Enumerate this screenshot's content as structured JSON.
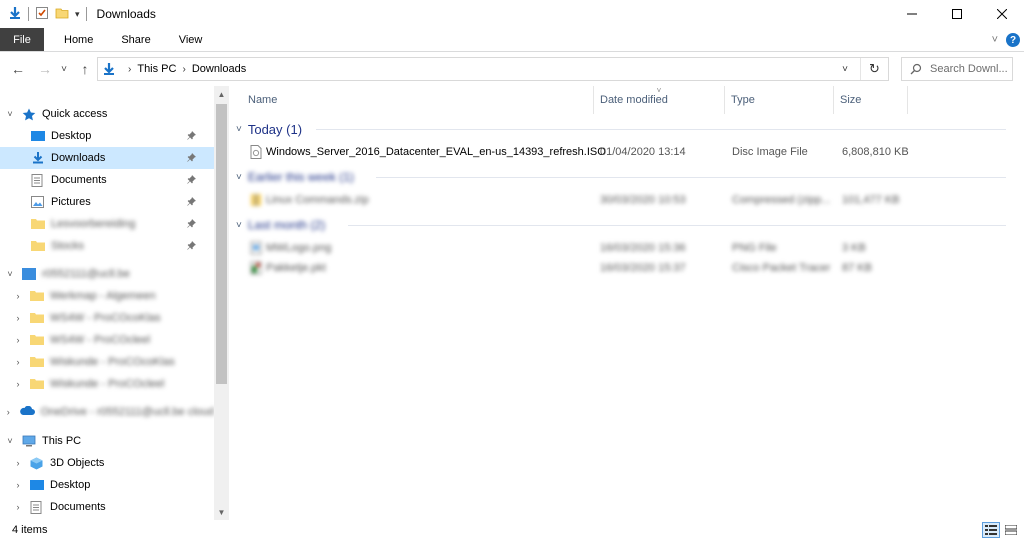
{
  "window": {
    "title": "Downloads",
    "controls": {
      "minimize": "—",
      "maximize": "☐",
      "close": "✕"
    }
  },
  "ribbon": {
    "tabs": [
      {
        "label": "File"
      },
      {
        "label": "Home"
      },
      {
        "label": "Share"
      },
      {
        "label": "View"
      }
    ],
    "expand": "˅",
    "help": "?"
  },
  "navbar": {
    "back": "←",
    "forward": "→",
    "recent": "˅",
    "up": "↑",
    "breadcrumb": [
      "This PC",
      "Downloads"
    ],
    "dropdown": "˅",
    "refresh": "↻",
    "search_placeholder": "Search Downl..."
  },
  "tree": {
    "quick_access": "Quick access",
    "pinned": [
      {
        "label": "Desktop",
        "icon": "desktop-icon",
        "selected": false
      },
      {
        "label": "Downloads",
        "icon": "downloads-icon",
        "selected": true
      },
      {
        "label": "Documents",
        "icon": "documents-icon",
        "selected": false
      },
      {
        "label": "Pictures",
        "icon": "pictures-icon",
        "selected": false
      },
      {
        "label": "Lesvoorbereiding",
        "icon": "folder-icon",
        "selected": false,
        "blurred": true
      },
      {
        "label": "Stocks",
        "icon": "folder-icon",
        "selected": false,
        "blurred": true
      }
    ],
    "onedrive_business": {
      "label": "r0552111@ucll.be",
      "children": [
        "Werkmap - Algemeen",
        "WS4W - ProCOcoKlas",
        "WS4W - ProCOcleel",
        "Wiskunde - ProCOcoKlas",
        "Wiskunde - ProCOcleel"
      ]
    },
    "onedrive_personal": "OneDrive - r0552111@ucll.be cloud",
    "this_pc": {
      "label": "This PC",
      "children": [
        {
          "label": "3D Objects",
          "icon": "3d-objects-icon"
        },
        {
          "label": "Desktop",
          "icon": "desktop-icon"
        },
        {
          "label": "Documents",
          "icon": "documents-icon"
        }
      ]
    },
    "pin_glyph": "📌"
  },
  "columns": [
    {
      "label": "Name"
    },
    {
      "label": "Date modified"
    },
    {
      "label": "Type"
    },
    {
      "label": "Size"
    }
  ],
  "groups": [
    {
      "label": "Today (1)",
      "blurred": false,
      "items": [
        {
          "name": "Windows_Server_2016_Datacenter_EVAL_en-us_14393_refresh.ISO",
          "date": "01/04/2020 13:14",
          "type": "Disc Image File",
          "size": "6,808,810 KB",
          "icon": "disc-image-icon"
        }
      ]
    },
    {
      "label": "Earlier this week (1)",
      "blurred": true,
      "items": [
        {
          "name": "Linux Commands.zip",
          "date": "30/03/2020 10:53",
          "type": "Compressed (zipp...",
          "size": "101,477 KB",
          "icon": "zip-folder-icon"
        }
      ]
    },
    {
      "label": "Last month (2)",
      "blurred": true,
      "items": [
        {
          "name": "MWLogo.png",
          "date": "16/03/2020 15:36",
          "type": "PNG File",
          "size": "3 KB",
          "icon": "png-file-icon"
        },
        {
          "name": "Pakketje.pkt",
          "date": "16/03/2020 15:37",
          "type": "Cisco Packet Tracer",
          "size": "87 KB",
          "icon": "packet-tracer-icon"
        }
      ]
    }
  ],
  "status": {
    "count": "4 items"
  },
  "colors": {
    "accent": "#1a73c8",
    "selected": "#cce8ff",
    "group_header": "#1e3287"
  }
}
